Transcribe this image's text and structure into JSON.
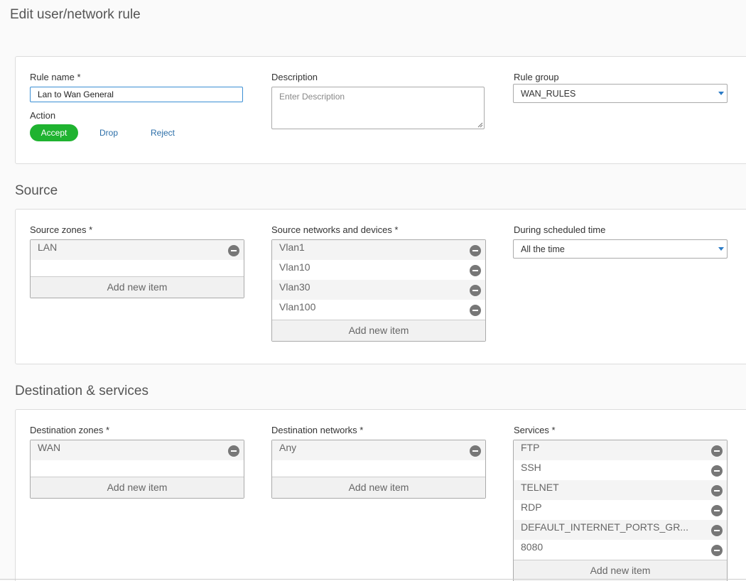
{
  "page": {
    "title": "Edit user/network rule"
  },
  "rule": {
    "name_label": "Rule name *",
    "name_value": "Lan to Wan General",
    "description_label": "Description",
    "description_placeholder": "Enter Description",
    "group_label": "Rule group",
    "group_value": "WAN_RULES",
    "action_label": "Action",
    "actions": [
      {
        "label": "Accept",
        "selected": true
      },
      {
        "label": "Drop",
        "selected": false
      },
      {
        "label": "Reject",
        "selected": false
      }
    ]
  },
  "source": {
    "title": "Source",
    "zones_label": "Source zones *",
    "zones": [
      "LAN"
    ],
    "networks_label": "Source networks and devices *",
    "networks": [
      "Vlan1",
      "Vlan10",
      "Vlan30",
      "Vlan100"
    ],
    "schedule_label": "During scheduled time",
    "schedule_value": "All the time"
  },
  "destination": {
    "title": "Destination & services",
    "zones_label": "Destination zones *",
    "zones": [
      "WAN"
    ],
    "networks_label": "Destination networks *",
    "networks": [
      "Any"
    ],
    "services_label": "Services *",
    "services": [
      "FTP",
      "SSH",
      "TELNET",
      "RDP",
      "DEFAULT_INTERNET_PORTS_GR...",
      "8080"
    ]
  },
  "common": {
    "add_new_item": "Add new item"
  },
  "colors": {
    "accent": "#2b7bc6",
    "accept": "#1fb330",
    "link": "#2b6ea8"
  }
}
